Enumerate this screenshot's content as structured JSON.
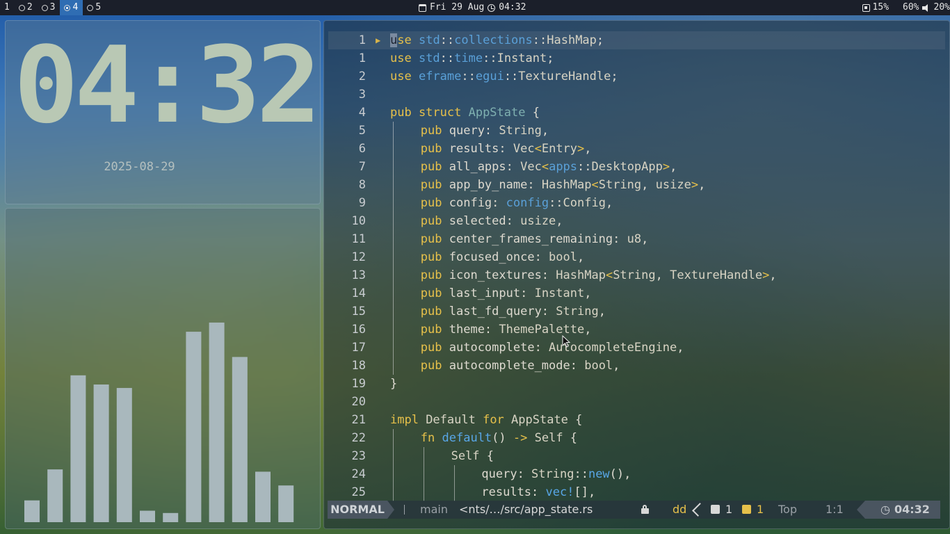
{
  "topbar": {
    "workspaces": [
      {
        "label": "1",
        "has_icon": false,
        "active": false
      },
      {
        "label": "2",
        "has_icon": true,
        "active": false
      },
      {
        "label": "3",
        "has_icon": true,
        "active": false
      },
      {
        "label": "4",
        "has_icon": true,
        "active": true
      },
      {
        "label": "5",
        "has_icon": true,
        "active": false
      }
    ],
    "date": "Fri 29 Aug",
    "time": "04:32",
    "cpu": "15%",
    "memory": "60%",
    "volume": "20%"
  },
  "clock_widget": {
    "time": "04:32",
    "date": "2025-08-29"
  },
  "visualizer": {
    "bar_color": "#a9b8bd",
    "levels": [
      0.095,
      0.23,
      0.64,
      0.6,
      0.585,
      0.05,
      0.04,
      0.83,
      0.87,
      0.72,
      0.22,
      0.16
    ]
  },
  "editor": {
    "lines": [
      {
        "num": "1",
        "current": true,
        "fold": true,
        "indent": 0,
        "tokens": [
          [
            "cursor",
            "u"
          ],
          [
            "kw",
            "se "
          ],
          [
            "ns",
            "std"
          ],
          [
            "pn",
            "::"
          ],
          [
            "ns",
            "collections"
          ],
          [
            "pn",
            "::"
          ],
          [
            "ty",
            "HashMap"
          ],
          [
            "pn",
            ";"
          ]
        ]
      },
      {
        "num": "1",
        "indent": 0,
        "tokens": [
          [
            "kw",
            "use "
          ],
          [
            "ns",
            "std"
          ],
          [
            "pn",
            "::"
          ],
          [
            "ns",
            "time"
          ],
          [
            "pn",
            "::"
          ],
          [
            "ty",
            "Instant"
          ],
          [
            "pn",
            ";"
          ]
        ]
      },
      {
        "num": "2",
        "indent": 0,
        "tokens": [
          [
            "kw",
            "use "
          ],
          [
            "ns",
            "eframe"
          ],
          [
            "pn",
            "::"
          ],
          [
            "ns",
            "egui"
          ],
          [
            "pn",
            "::"
          ],
          [
            "ty",
            "TextureHandle"
          ],
          [
            "pn",
            ";"
          ]
        ]
      },
      {
        "num": "3",
        "indent": 0,
        "tokens": []
      },
      {
        "num": "4",
        "indent": 0,
        "tokens": [
          [
            "kw",
            "pub struct "
          ],
          [
            "tp",
            "AppState"
          ],
          [
            "pn",
            " {"
          ]
        ]
      },
      {
        "num": "5",
        "indent": 1,
        "tokens": [
          [
            "kw",
            "pub "
          ],
          [
            "pn",
            "query: "
          ],
          [
            "ty",
            "String"
          ],
          [
            "pn",
            ","
          ]
        ]
      },
      {
        "num": "6",
        "indent": 1,
        "tokens": [
          [
            "kw",
            "pub "
          ],
          [
            "pn",
            "results: "
          ],
          [
            "ty",
            "Vec"
          ],
          [
            "kw",
            "<"
          ],
          [
            "ty",
            "Entry"
          ],
          [
            "kw",
            ">"
          ],
          [
            "pn",
            ","
          ]
        ]
      },
      {
        "num": "7",
        "indent": 1,
        "tokens": [
          [
            "kw",
            "pub "
          ],
          [
            "pn",
            "all_apps: "
          ],
          [
            "ty",
            "Vec"
          ],
          [
            "kw",
            "<"
          ],
          [
            "ns",
            "apps"
          ],
          [
            "pn",
            "::"
          ],
          [
            "ty",
            "DesktopApp"
          ],
          [
            "kw",
            ">"
          ],
          [
            "pn",
            ","
          ]
        ]
      },
      {
        "num": "8",
        "indent": 1,
        "tokens": [
          [
            "kw",
            "pub "
          ],
          [
            "pn",
            "app_by_name: "
          ],
          [
            "ty",
            "HashMap"
          ],
          [
            "kw",
            "<"
          ],
          [
            "ty",
            "String"
          ],
          [
            "pn",
            ", "
          ],
          [
            "ty",
            "usize"
          ],
          [
            "kw",
            ">"
          ],
          [
            "pn",
            ","
          ]
        ]
      },
      {
        "num": "9",
        "indent": 1,
        "tokens": [
          [
            "kw",
            "pub "
          ],
          [
            "pn",
            "config: "
          ],
          [
            "ns",
            "config"
          ],
          [
            "pn",
            "::"
          ],
          [
            "ty",
            "Config"
          ],
          [
            "pn",
            ","
          ]
        ]
      },
      {
        "num": "10",
        "indent": 1,
        "tokens": [
          [
            "kw",
            "pub "
          ],
          [
            "pn",
            "selected: "
          ],
          [
            "ty",
            "usize"
          ],
          [
            "pn",
            ","
          ]
        ]
      },
      {
        "num": "11",
        "indent": 1,
        "tokens": [
          [
            "kw",
            "pub "
          ],
          [
            "pn",
            "center_frames_remaining: "
          ],
          [
            "ty",
            "u8"
          ],
          [
            "pn",
            ","
          ]
        ]
      },
      {
        "num": "12",
        "indent": 1,
        "tokens": [
          [
            "kw",
            "pub "
          ],
          [
            "pn",
            "focused_once: "
          ],
          [
            "ty",
            "bool"
          ],
          [
            "pn",
            ","
          ]
        ]
      },
      {
        "num": "13",
        "indent": 1,
        "tokens": [
          [
            "kw",
            "pub "
          ],
          [
            "pn",
            "icon_textures: "
          ],
          [
            "ty",
            "HashMap"
          ],
          [
            "kw",
            "<"
          ],
          [
            "ty",
            "String"
          ],
          [
            "pn",
            ", "
          ],
          [
            "ty",
            "TextureHandle"
          ],
          [
            "kw",
            ">"
          ],
          [
            "pn",
            ","
          ]
        ]
      },
      {
        "num": "14",
        "indent": 1,
        "tokens": [
          [
            "kw",
            "pub "
          ],
          [
            "pn",
            "last_input: "
          ],
          [
            "ty",
            "Instant"
          ],
          [
            "pn",
            ","
          ]
        ]
      },
      {
        "num": "15",
        "indent": 1,
        "tokens": [
          [
            "kw",
            "pub "
          ],
          [
            "pn",
            "last_fd_query: "
          ],
          [
            "ty",
            "String"
          ],
          [
            "pn",
            ","
          ]
        ]
      },
      {
        "num": "16",
        "indent": 1,
        "tokens": [
          [
            "kw",
            "pub "
          ],
          [
            "pn",
            "theme: "
          ],
          [
            "ty",
            "ThemePalette"
          ],
          [
            "pn",
            ","
          ]
        ]
      },
      {
        "num": "17",
        "indent": 1,
        "tokens": [
          [
            "kw",
            "pub "
          ],
          [
            "pn",
            "autocomplete: "
          ],
          [
            "ty",
            "AutocompleteEngine"
          ],
          [
            "pn",
            ","
          ]
        ]
      },
      {
        "num": "18",
        "indent": 1,
        "tokens": [
          [
            "kw",
            "pub "
          ],
          [
            "pn",
            "autocomplete_mode: "
          ],
          [
            "ty",
            "bool"
          ],
          [
            "pn",
            ","
          ]
        ]
      },
      {
        "num": "19",
        "indent": 0,
        "tokens": [
          [
            "pn",
            "}"
          ]
        ]
      },
      {
        "num": "20",
        "indent": 0,
        "tokens": []
      },
      {
        "num": "21",
        "indent": 0,
        "tokens": [
          [
            "kw",
            "impl "
          ],
          [
            "ty",
            "Default "
          ],
          [
            "kw",
            "for "
          ],
          [
            "ty",
            "AppState"
          ],
          [
            "pn",
            " {"
          ]
        ]
      },
      {
        "num": "22",
        "indent": 1,
        "tokens": [
          [
            "kw",
            "fn "
          ],
          [
            "fn",
            "default"
          ],
          [
            "pn",
            "() "
          ],
          [
            "kw",
            "-> "
          ],
          [
            "ty",
            "Self"
          ],
          [
            "pn",
            " {"
          ]
        ]
      },
      {
        "num": "23",
        "indent": 2,
        "tokens": [
          [
            "ty",
            "Self"
          ],
          [
            "pn",
            " {"
          ]
        ]
      },
      {
        "num": "24",
        "indent": 3,
        "tokens": [
          [
            "pn",
            "query: "
          ],
          [
            "ty",
            "String"
          ],
          [
            "pn",
            "::"
          ],
          [
            "fn",
            "new"
          ],
          [
            "pn",
            "(),"
          ]
        ]
      },
      {
        "num": "25",
        "indent": 3,
        "tokens": [
          [
            "pn",
            "results: "
          ],
          [
            "fn",
            "vec!"
          ],
          [
            "pn",
            "[],"
          ]
        ]
      }
    ]
  },
  "statusline": {
    "mode": "NORMAL",
    "branch": "main",
    "file": "<nts/…/src/app_state.rs",
    "pending_keys": "dd",
    "hints_count": "1",
    "warnings_count": "1",
    "scroll": "Top",
    "position": "1:1",
    "time": "04:32"
  }
}
